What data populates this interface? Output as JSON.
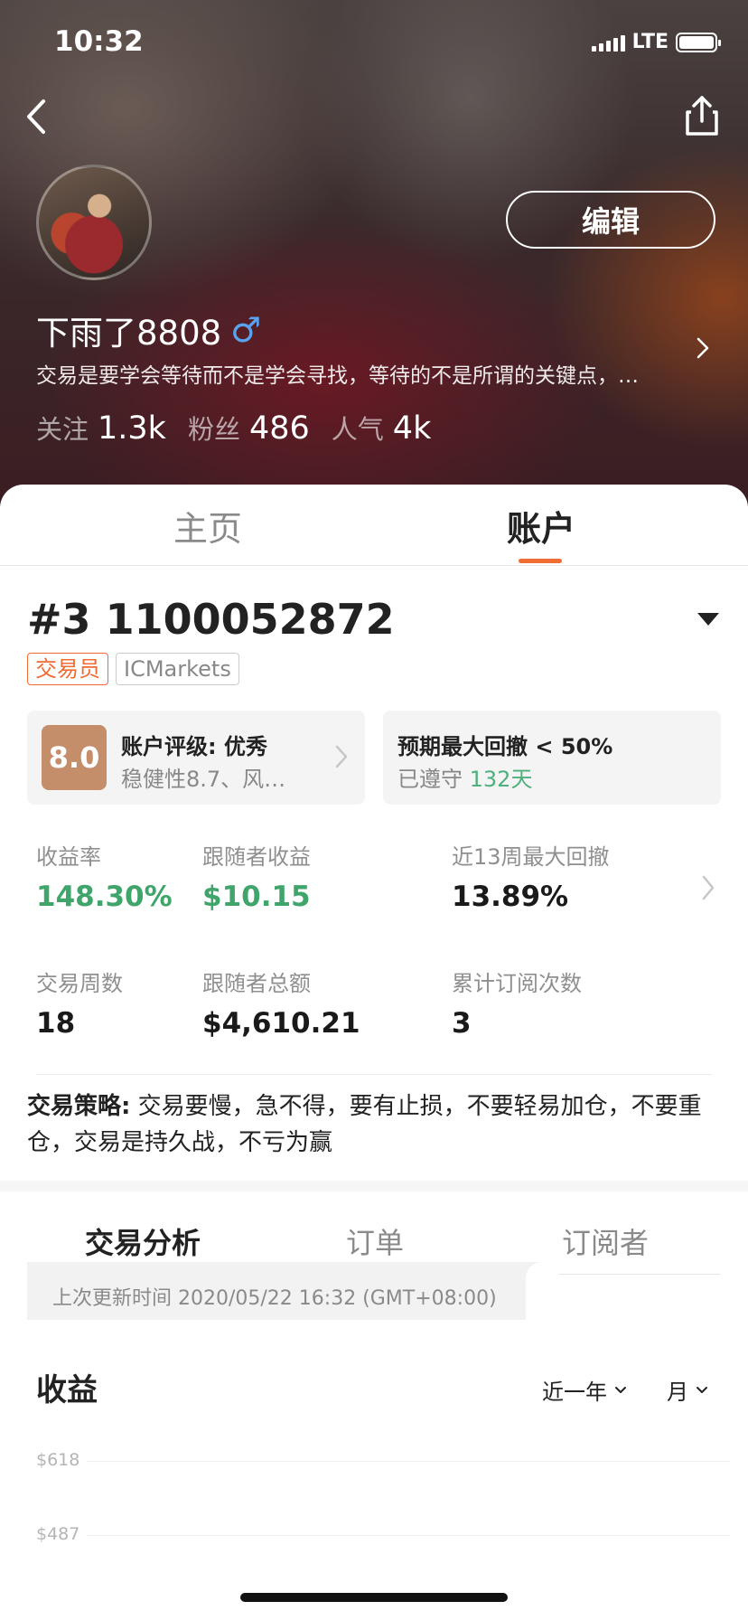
{
  "status_bar": {
    "time": "10:32",
    "network": "LTE"
  },
  "profile": {
    "edit_label": "编辑",
    "username": "下雨了8808",
    "gender_symbol": "♂",
    "bio": "交易是要学会等待而不是学会寻找，等待的不是所谓的关键点，…",
    "stats": [
      {
        "label": "关注",
        "value": "1.3k"
      },
      {
        "label": "粉丝",
        "value": "486"
      },
      {
        "label": "人气",
        "value": "4k"
      }
    ]
  },
  "tabs_top": {
    "home": "主页",
    "account": "账户",
    "active": "账户"
  },
  "account": {
    "id_label": "#3 1100052872",
    "tag_role": "交易员",
    "tag_broker": "ICMarkets",
    "rating": {
      "score": "8.0",
      "title": "账户评级: 优秀",
      "subtitle": "稳健性8.7、风…"
    },
    "drawdown": {
      "title": "预期最大回撤 < 50%",
      "kept_prefix": "已遵守",
      "kept_days": "132天"
    },
    "metrics": {
      "return_rate": {
        "label": "收益率",
        "value": "148.30%"
      },
      "follower_profit": {
        "label": "跟随者收益",
        "value": "$10.15"
      },
      "max_dd_13w": {
        "label": "近13周最大回撤",
        "value": "13.89%"
      },
      "trade_weeks": {
        "label": "交易周数",
        "value": "18"
      },
      "follower_total": {
        "label": "跟随者总额",
        "value": "$4,610.21"
      },
      "sub_count": {
        "label": "累计订阅次数",
        "value": "3"
      }
    },
    "strategy_label": "交易策略:",
    "strategy_text": " 交易要慢，急不得，要有止损，不要轻易加仓，不要重仓，交易是持久战，不亏为赢"
  },
  "tabs_bottom": {
    "analysis": "交易分析",
    "orders": "订单",
    "subscribers": "订阅者",
    "active": "交易分析"
  },
  "update_time": "上次更新时间 2020/05/22 16:32 (GMT+08:00)",
  "chart": {
    "title": "收益",
    "period": "近一年",
    "granularity": "月",
    "y_ticks": [
      "$618",
      "$487"
    ]
  },
  "colors": {
    "accent": "#ef6c35",
    "positive": "#3fa56b",
    "rating_badge": "#c48e6b"
  }
}
